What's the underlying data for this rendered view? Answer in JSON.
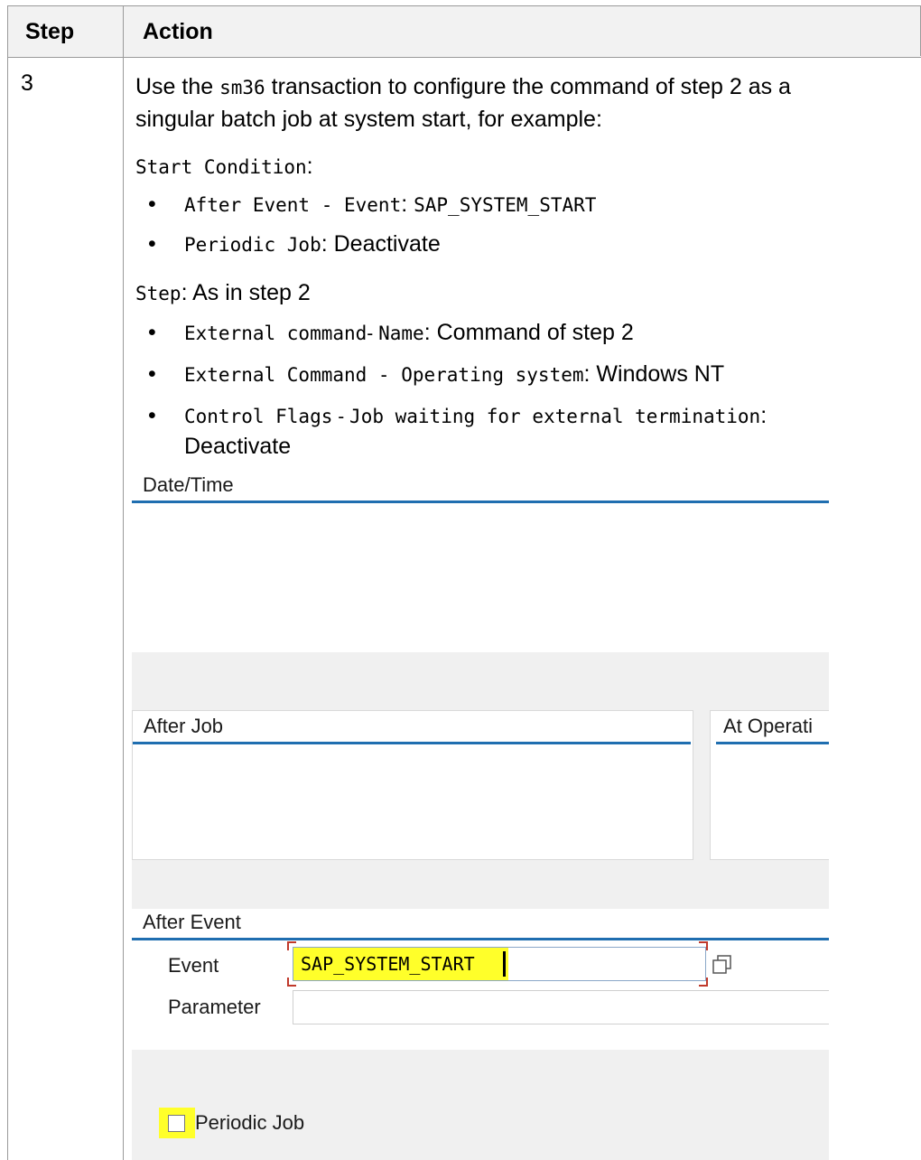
{
  "table": {
    "headers": {
      "step": "Step",
      "action": "Action"
    },
    "step_number": "3",
    "intro": {
      "prefix": "Use the ",
      "code": "sm36",
      "line1_suffix": " transaction to configure the command of step 2 as a",
      "line2": "singular batch job at system start, for example:"
    },
    "start_condition": {
      "label": "Start Condition",
      "colon": ":"
    },
    "start_bullets": [
      {
        "code": "After Event - Event",
        "sep": ": ",
        "value_code": "SAP_SYSTEM_START"
      },
      {
        "code": "Periodic Job",
        "sep": ": ",
        "value": "Deactivate"
      }
    ],
    "step_line": {
      "code": "Step",
      "sep": ": ",
      "value": "As in step 2"
    },
    "step_bullets": [
      {
        "code": "External command",
        "mid": "- ",
        "code2": "Name",
        "sep": ": ",
        "value": "Command of step 2"
      },
      {
        "code": "External Command - Operating system",
        "sep": ": ",
        "value": "Windows NT"
      },
      {
        "code": "Control Flags",
        "mid": " - ",
        "code2": "Job waiting for external termination",
        "sep": ":",
        "value": "Deactivate"
      }
    ]
  },
  "sap_screen": {
    "date_time_title": "Date/Time",
    "after_job_title": "After Job",
    "at_operation_title": "At Operati",
    "after_event_title": "After Event",
    "event_label": "Event",
    "event_value": "SAP_SYSTEM_START",
    "parameter_label": "Parameter",
    "parameter_value": "",
    "periodic_job_label": "Periodic Job",
    "periodic_job_checked": false,
    "highlight_color": "#ffff2a",
    "rule_color": "#1f6eb0"
  }
}
